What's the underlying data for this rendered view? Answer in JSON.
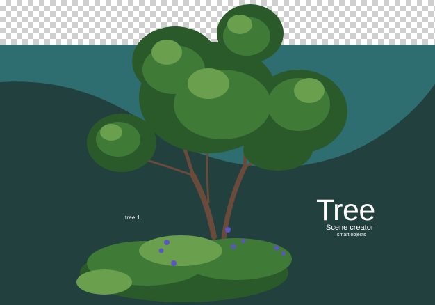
{
  "scene": {
    "tree_label": "tree 1",
    "brand_title": "Tree",
    "brand_subtitle": "Scene creator",
    "brand_tagline": "smart objects"
  },
  "colors": {
    "upper_teal": "#2f6e70",
    "lower_teal": "#21403e",
    "foliage_dark": "#2b5a2a",
    "foliage_mid": "#3f7a37",
    "foliage_light": "#6a9f4e",
    "trunk": "#6a4a3a",
    "flower": "#5b55c4",
    "text": "#ffffff"
  },
  "icons": {
    "tree": "tree-illustration",
    "shrub": "shrub-illustration"
  }
}
